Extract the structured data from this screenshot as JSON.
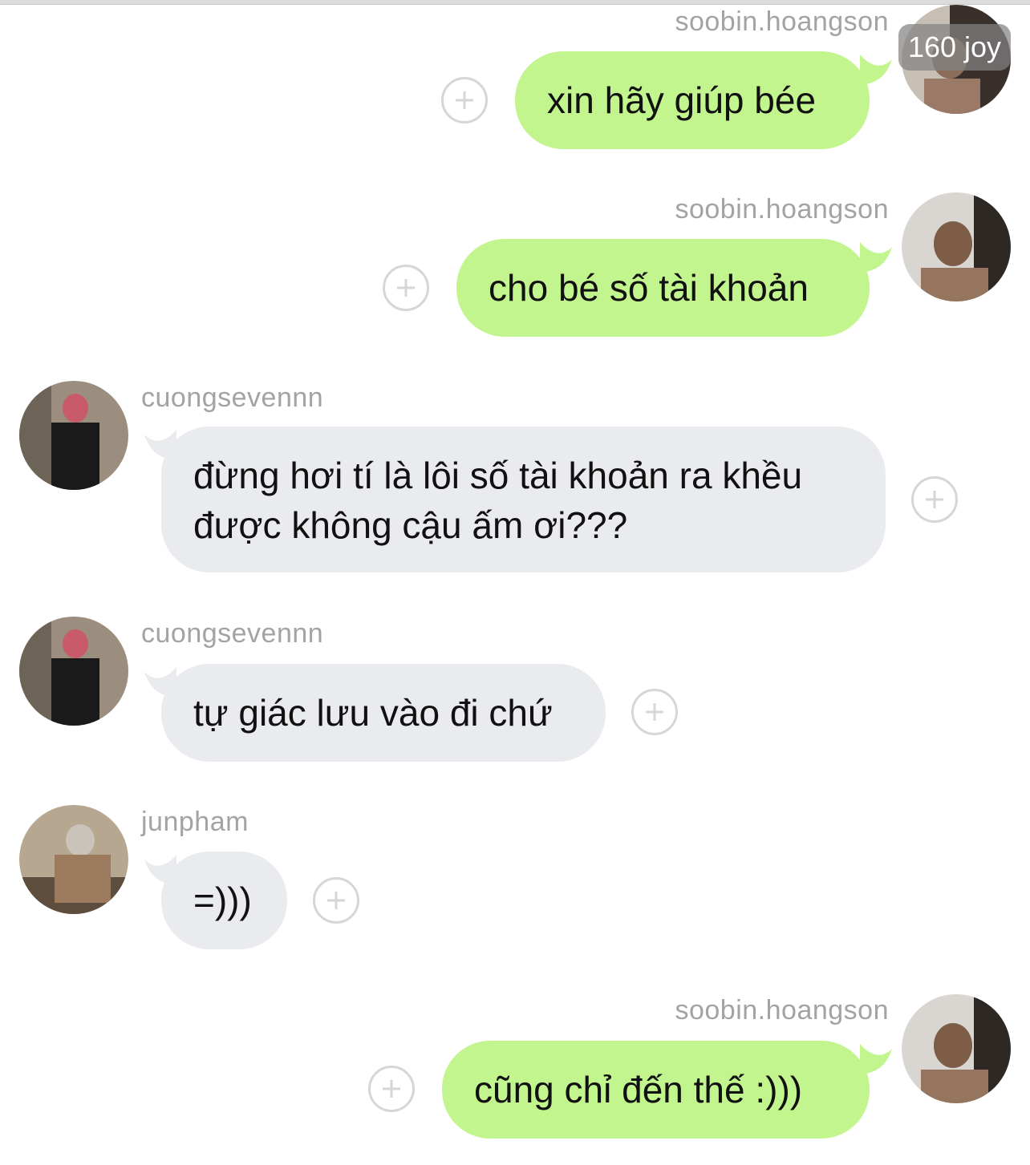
{
  "messages": [
    {
      "sender": "soobin.hoangson",
      "text": "xin hãy giúp bée",
      "side": "right"
    },
    {
      "sender": "soobin.hoangson",
      "text": "cho bé số tài khoản",
      "side": "right"
    },
    {
      "sender": "cuongsevennn",
      "text": "đừng hơi tí là lôi số tài khoản ra khều được không cậu ấm ơi???",
      "side": "left"
    },
    {
      "sender": "cuongsevennn",
      "text": "tự giác lưu vào đi chứ",
      "side": "left"
    },
    {
      "sender": "junpham",
      "text": "=)))",
      "side": "left"
    },
    {
      "sender": "soobin.hoangson",
      "text": "cũng chỉ đến thế :)))",
      "side": "right"
    }
  ],
  "badge": {
    "label": "160 joy"
  },
  "colors": {
    "outgoing_bubble": "#c3f58e",
    "incoming_bubble": "#e9ebee",
    "sender_name": "#a3a3a3",
    "plus_icon": "#d6d6d6"
  },
  "icons": {
    "reaction": "plus-circle-icon",
    "avatar": "user-avatar"
  }
}
